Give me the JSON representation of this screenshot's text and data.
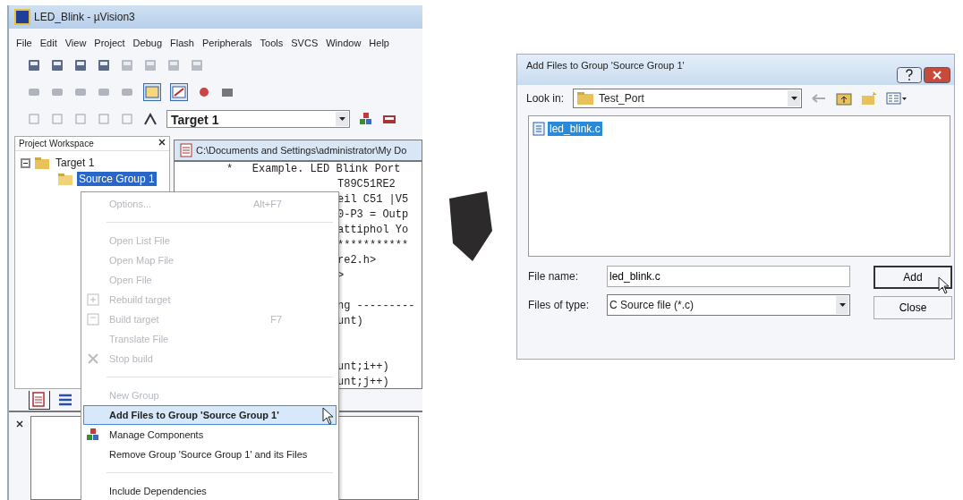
{
  "main_window": {
    "title": "LED_Blink - µVision3",
    "menu": [
      "File",
      "Edit",
      "View",
      "Project",
      "Debug",
      "Flash",
      "Peripherals",
      "Tools",
      "SVCS",
      "Window",
      "Help"
    ],
    "target_select": "Target 1",
    "workspace": {
      "title": "Project Workspace",
      "tree": [
        {
          "label": "Target 1",
          "expanded": true,
          "selected": false,
          "children": [
            {
              "label": "Source Group 1",
              "selected": true
            }
          ]
        }
      ]
    },
    "editor": {
      "path": "C:\\Documents and Settings\\administrator\\My Do",
      "lines": [
        {
          "kind": "full",
          "text": "*   Example. LED Blink Port"
        },
        {
          "kind": "partial",
          "text": "T89C51RE2"
        },
        {
          "kind": "partial",
          "text": "eil C51 |V5"
        },
        {
          "kind": "partial",
          "text": "0-P3 = Outp"
        },
        {
          "kind": "partial",
          "text": "attiphol Yo"
        },
        {
          "kind": "partial",
          "text": "***********"
        },
        {
          "kind": "partial",
          "text": "re2.h>"
        },
        {
          "kind": "partial",
          "text": ">"
        },
        {
          "kind": "blank"
        },
        {
          "kind": "partial",
          "text": "ng ---------"
        },
        {
          "kind": "partial",
          "text": "unt)"
        },
        {
          "kind": "blank"
        },
        {
          "kind": "blank"
        },
        {
          "kind": "partial",
          "text": "unt;i++)"
        },
        {
          "kind": "partial",
          "text": "unt;j++)"
        }
      ]
    },
    "context_menu": [
      {
        "kind": "item",
        "label": "Options...",
        "shortcut": "Alt+F7",
        "disabled": true,
        "selected": false
      },
      {
        "kind": "separator"
      },
      {
        "kind": "item",
        "label": "Open List File",
        "disabled": true,
        "selected": false
      },
      {
        "kind": "item",
        "label": "Open Map File",
        "disabled": true,
        "selected": false
      },
      {
        "kind": "item",
        "label": "Open File",
        "disabled": true,
        "selected": false
      },
      {
        "kind": "item",
        "label": "Rebuild target",
        "disabled": true,
        "selected": false
      },
      {
        "kind": "item",
        "label": "Build target",
        "shortcut": "F7",
        "disabled": true,
        "selected": false
      },
      {
        "kind": "item",
        "label": "Translate File",
        "disabled": true,
        "selected": false
      },
      {
        "kind": "item",
        "label": "Stop build",
        "disabled": true,
        "selected": false
      },
      {
        "kind": "separator"
      },
      {
        "kind": "item",
        "label": "New Group",
        "disabled": true,
        "selected": false
      },
      {
        "kind": "item",
        "label": "Add Files to Group 'Source Group 1'",
        "disabled": false,
        "selected": true
      },
      {
        "kind": "item",
        "label": "Manage Components",
        "disabled": false,
        "selected": false
      },
      {
        "kind": "item",
        "label": "Remove Group 'Source Group 1' and its Files",
        "disabled": false,
        "selected": false
      },
      {
        "kind": "separator"
      },
      {
        "kind": "item",
        "label": "Include Dependencies",
        "disabled": false,
        "selected": false
      }
    ]
  },
  "dialog": {
    "title": "Add Files to Group 'Source Group 1'",
    "look_in": {
      "label": "Look in:",
      "value": "Test_Port"
    },
    "files": [
      {
        "name": "led_blink.c",
        "selected": true
      }
    ],
    "file_name": {
      "label": "File name:",
      "value": "led_blink.c"
    },
    "file_type": {
      "label": "Files of type:",
      "value": "C Source file (*.c)"
    },
    "buttons": [
      {
        "label": "Add",
        "focused": true
      },
      {
        "label": "Close",
        "focused": false
      }
    ]
  }
}
